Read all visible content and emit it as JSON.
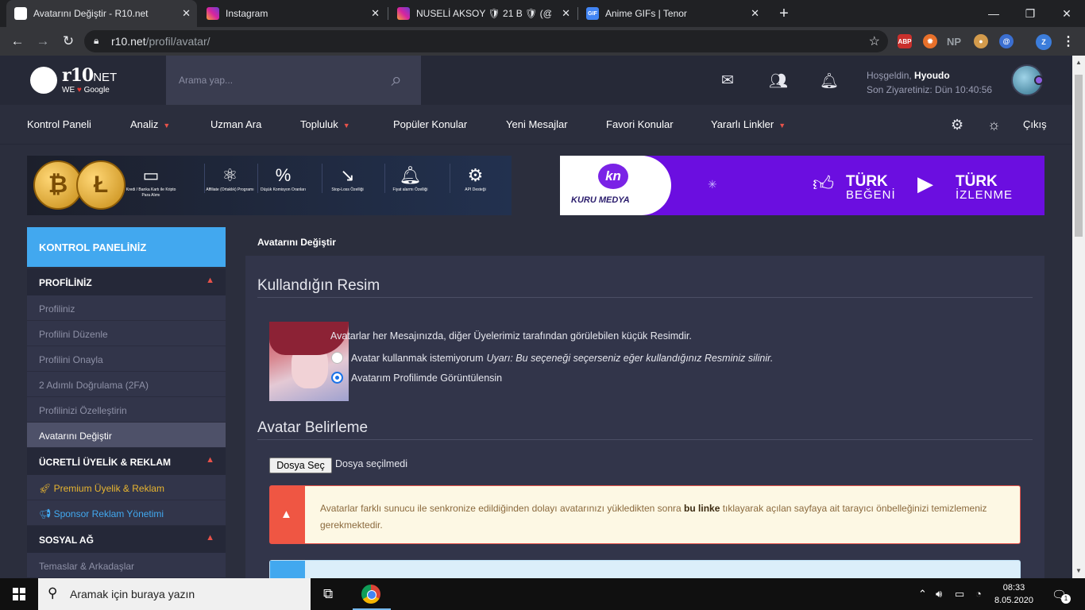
{
  "browser": {
    "tabs": [
      {
        "title": "Avatarını Değiştir - R10.net",
        "active": true
      },
      {
        "title": "Instagram",
        "active": false
      },
      {
        "title": "NUSELİ AKSOY 🛡 21 B 🛡 (@",
        "active": false
      },
      {
        "title": "Anime GIFs | Tenor",
        "active": false
      }
    ],
    "url_domain": "r10.net",
    "url_path": "/profil/avatar/",
    "extensions": [
      "ABP",
      "NP"
    ]
  },
  "header": {
    "logo_text": "r10",
    "logo_suffix": "NET",
    "logo_tag_we": "WE",
    "logo_tag_google": "Google",
    "search_placeholder": "Arama yap...",
    "welcome_label": "Hoşgeldin,",
    "username": "Hyoudo",
    "last_visit": "Son Ziyaretiniz: Dün 10:40:56"
  },
  "nav": {
    "items": [
      "Kontrol Paneli",
      "Analiz",
      "Uzman Ara",
      "Topluluk",
      "Popüler Konular",
      "Yeni Mesajlar",
      "Favori Konular",
      "Yararlı Linkler"
    ],
    "logout": "Çıkış"
  },
  "banner_left": {
    "features": [
      "Kredi / Banka Kartı ile Kripto Para Alımı",
      "Affiliate (Ortaklık) Programı",
      "Düşük Komisyon Oranları",
      "Stop-Loss Özelliği",
      "Fiyat alarmı Özelliği",
      "API Desteği"
    ]
  },
  "banner_right": {
    "brand_badge": "kn",
    "brand": "KURU MEDYA",
    "offer1_title": "TÜRK",
    "offer1_sub": "BEĞENİ",
    "offer2_title": "TÜRK",
    "offer2_sub": "İZLENME"
  },
  "sidebar": {
    "title": "KONTROL PANELİNİZ",
    "sections": [
      {
        "label": "PROFİLİNİZ"
      },
      {
        "label": "ÜCRETLİ ÜYELİK & REKLAM"
      },
      {
        "label": "SOSYAL AĞ"
      }
    ],
    "profile_items": [
      "Profiliniz",
      "Profilini Düzenle",
      "Profilini Onayla",
      "2 Adımlı Doğrulama (2FA)",
      "Profilinizi Özelleştirin",
      "Avatarını Değiştir"
    ],
    "paid_items": [
      "Premium Üyelik & Reklam",
      "Sponsor Reklam Yönetimi"
    ],
    "social_items": [
      "Temaslar & Arkadaşlar"
    ]
  },
  "main": {
    "panel_title": "Avatarını Değiştir",
    "section1_title": "Kullandığın Resim",
    "avatar_desc": "Avatarlar her Mesajınızda, diğer Üyelerimiz tarafından görülebilen küçük Resimdir.",
    "option_no_avatar": "Avatar kullanmak istemiyorum",
    "option_no_avatar_warning": "Uyarı: Bu seçeneği seçerseniz eğer kullandığınız Resminiz silinir.",
    "option_show_avatar": "Avatarım Profilimde Görüntülensin",
    "selected_option": "show",
    "section2_title": "Avatar Belirleme",
    "file_button": "Dosya Seç",
    "file_status": "Dosya seçilmedi",
    "warning_before": "Avatarlar farklı sunucu ile senkronize edildiğinden dolayı avatarınızı yükledikten sonra ",
    "warning_link": "bu linke",
    "warning_after": " tıklayarak açılan sayfaya ait tarayıcı önbelleğinizi temizlemeniz gerekmektedir."
  },
  "taskbar": {
    "search_placeholder": "Aramak için buraya yazın",
    "time": "08:33",
    "date": "8.05.2020",
    "notification_count": "1"
  },
  "colors": {
    "accent_blue": "#42a8ef",
    "accent_red": "#e8524a",
    "page_bg": "#2b2e3d",
    "panel_bg": "#32354a",
    "promo_purple": "#6b0ee0"
  }
}
